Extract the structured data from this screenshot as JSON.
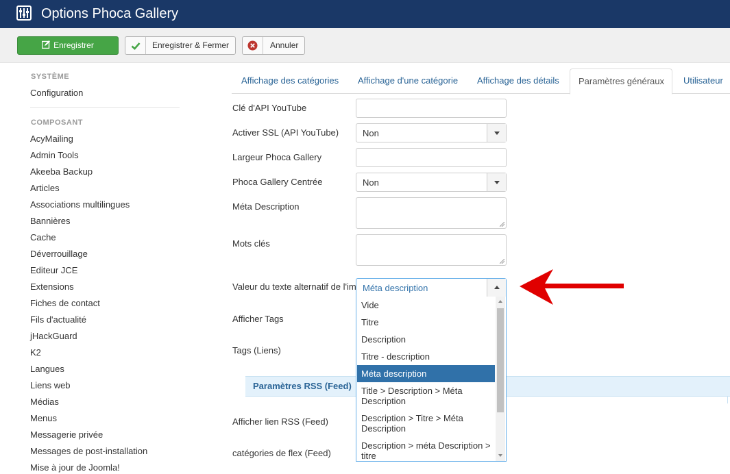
{
  "header": {
    "title": "Options Phoca Gallery"
  },
  "toolbar": {
    "save_label": "Enregistrer",
    "save_close_label": "Enregistrer & Fermer",
    "cancel_label": "Annuler",
    "save_color": "#46a546"
  },
  "sidebar": {
    "system_heading": "SYSTÈME",
    "system_items": [
      {
        "label": "Configuration"
      }
    ],
    "component_heading": "COMPOSANT",
    "component_items": [
      {
        "label": "AcyMailing"
      },
      {
        "label": "Admin Tools"
      },
      {
        "label": "Akeeba Backup"
      },
      {
        "label": "Articles"
      },
      {
        "label": "Associations multilingues"
      },
      {
        "label": "Bannières"
      },
      {
        "label": "Cache"
      },
      {
        "label": "Déverrouillage"
      },
      {
        "label": "Editeur JCE"
      },
      {
        "label": "Extensions"
      },
      {
        "label": "Fiches de contact"
      },
      {
        "label": "Fils d'actualité"
      },
      {
        "label": "jHackGuard"
      },
      {
        "label": "K2"
      },
      {
        "label": "Langues"
      },
      {
        "label": "Liens web"
      },
      {
        "label": "Médias"
      },
      {
        "label": "Menus"
      },
      {
        "label": "Messagerie privée"
      },
      {
        "label": "Messages de post-installation"
      },
      {
        "label": "Mise à jour de Joomla!"
      }
    ]
  },
  "tabs": [
    {
      "label": "Affichage des catégories"
    },
    {
      "label": "Affichage d'une catégorie"
    },
    {
      "label": "Affichage des détails"
    },
    {
      "label": "Paramètres généraux",
      "active": true
    },
    {
      "label": "Utilisateur"
    }
  ],
  "form": {
    "youtube_api_key": {
      "label": "Clé d'API YouTube",
      "value": ""
    },
    "ssl": {
      "label": "Activer SSL (API YouTube)",
      "value": "Non"
    },
    "width": {
      "label": "Largeur Phoca Gallery",
      "value": ""
    },
    "centered": {
      "label": "Phoca Gallery Centrée",
      "value": "Non"
    },
    "meta_description": {
      "label": "Méta Description",
      "value": ""
    },
    "keywords": {
      "label": "Mots clés",
      "value": ""
    },
    "alt_text": {
      "label": "Valeur du texte alternatif de l'image",
      "value": "Méta description",
      "options": [
        {
          "label": "Vide"
        },
        {
          "label": "Titre"
        },
        {
          "label": "Description"
        },
        {
          "label": "Titre - description"
        },
        {
          "label": "Méta description",
          "selected": true
        },
        {
          "label": "Title > Description > Méta Description"
        },
        {
          "label": "Description > Titre > Méta Description"
        },
        {
          "label": "Description > méta Description > titre"
        }
      ]
    },
    "show_tags": {
      "label": "Afficher Tags"
    },
    "tags_links": {
      "label": "Tags (Liens)"
    },
    "rss_section": {
      "label": "Paramètres RSS (Feed)"
    },
    "rss_link": {
      "label": "Afficher lien RSS (Feed)"
    },
    "flex_categories": {
      "label": "catégories de flex (Feed)"
    }
  },
  "colors": {
    "header_bg": "#1a3867",
    "link": "#2a6496",
    "selected_option": "#3071a9",
    "arrow": "#e00000"
  }
}
